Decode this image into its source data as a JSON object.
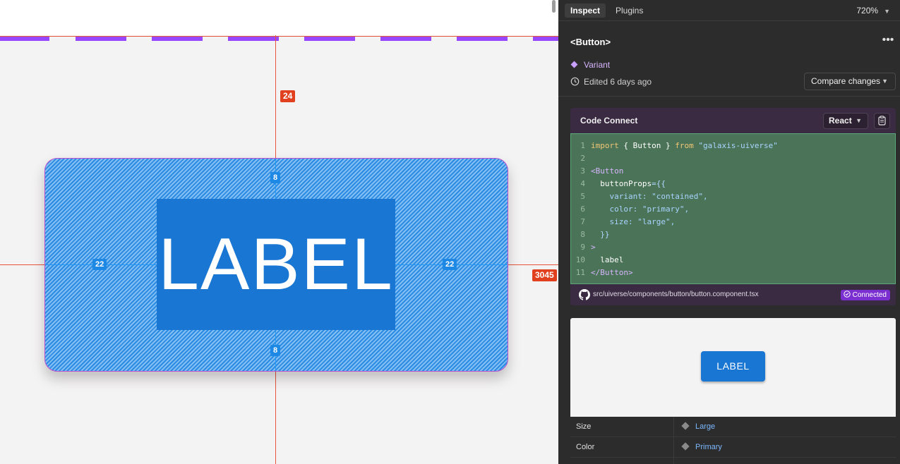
{
  "canvas": {
    "measure_top": "24",
    "measure_right": "3045",
    "padding_top": "8",
    "padding_bottom": "8",
    "padding_left": "22",
    "padding_right": "22",
    "button_label": "LABEL"
  },
  "panel": {
    "tabs": {
      "inspect": "Inspect",
      "plugins": "Plugins"
    },
    "zoom": "720%",
    "component_title": "<Button>",
    "variant_label": "Variant",
    "edited": "Edited 6 days ago",
    "compare_label": "Compare changes",
    "code_connect": {
      "title": "Code Connect",
      "framework": "React",
      "lines": [
        {
          "n": "1",
          "text": "import { Button } from \"galaxis-uiverse\""
        },
        {
          "n": "2",
          "text": ""
        },
        {
          "n": "3",
          "text": "<Button"
        },
        {
          "n": "4",
          "text": "  buttonProps={{"
        },
        {
          "n": "5",
          "text": "    variant: \"contained\","
        },
        {
          "n": "6",
          "text": "    color: \"primary\","
        },
        {
          "n": "7",
          "text": "    size: \"large\","
        },
        {
          "n": "8",
          "text": "  }}"
        },
        {
          "n": "9",
          "text": ">"
        },
        {
          "n": "10",
          "text": "  label"
        },
        {
          "n": "11",
          "text": "</Button>"
        }
      ],
      "file_path": "src/uiverse/components/button/button.component.tsx",
      "status": "Connected"
    },
    "preview_label": "LABEL",
    "properties": [
      {
        "name": "Size",
        "value": "Large"
      },
      {
        "name": "Color",
        "value": "Primary"
      }
    ]
  },
  "colors": {
    "accent_purple": "#9747ff",
    "measure_red": "#e0401d",
    "button_blue": "#1976d2",
    "code_bg": "#4b7358"
  }
}
